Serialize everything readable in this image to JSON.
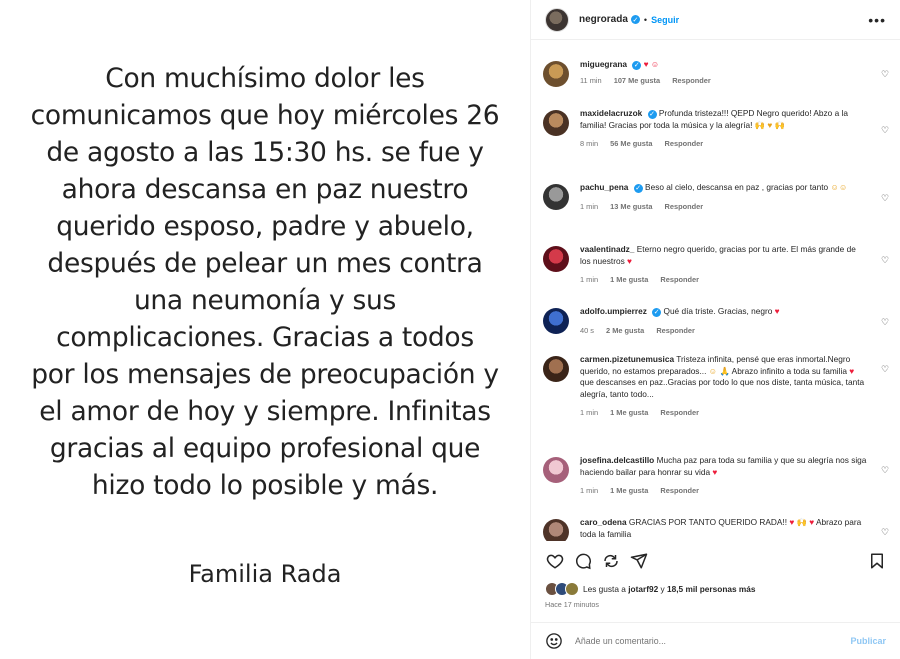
{
  "post": {
    "lines": [
      "Con muchísimo dolor les",
      "comunicamos que hoy miércoles 26",
      "de agosto a las 15:30 hs. se fue y",
      "ahora descansa en paz nuestro",
      "querido esposo, padre y abuelo,",
      "después de pelear un mes contra",
      "una neumonía y sus",
      "complicaciones. Gracias a todos",
      "por los mensajes de preocupación y",
      "el amor de hoy y siempre. Infinitas",
      "gracias al equipo profesional que",
      "hizo todo lo posible y más."
    ],
    "signature": "Familia Rada"
  },
  "header": {
    "username": "negrorada",
    "verified_icon": "verified-badge-icon",
    "follow_label": "Seguir",
    "more_icon": "more-options-icon"
  },
  "comments": [
    {
      "user": "miguegrana",
      "verified": true,
      "text": "",
      "emoji": "♥ ☺",
      "time": "11 min",
      "likes": "107 Me gusta",
      "reply": "Responder",
      "avatar_color": "#8a6a3a"
    },
    {
      "user": "maxidelacruzok",
      "verified": false,
      "text": "Profunda tristeza!!! QEPD Negro querido! Abzo a la familia! Gracias por toda la música y la alegría!",
      "emoji": "🙌 ♥ 🙌",
      "time": "8 min",
      "likes": "56 Me gusta",
      "reply": "Responder",
      "avatar_color": "#6b4a32"
    },
    {
      "user": "pachu_pena",
      "verified": true,
      "text": "Beso al cielo, descansa en paz , gracias por tanto",
      "emoji": "☺☺",
      "time": "1 min",
      "likes": "13 Me gusta",
      "reply": "Responder",
      "avatar_color": "#4a4a4a"
    },
    {
      "user": "vaalentinadz_",
      "verified": false,
      "text": "Eterno negro querido, gracias por tu arte. El más grande de los nuestros",
      "emoji": "♥",
      "time": "1 min",
      "likes": "1 Me gusta",
      "reply": "Responder",
      "avatar_color": "#9b1b2a"
    },
    {
      "user": "adolfo.umpierrez",
      "verified": true,
      "text": "Qué día triste. Gracias, negro",
      "emoji": "♥",
      "time": "40 s",
      "likes": "2 Me gusta",
      "reply": "Responder",
      "avatar_color": "#1c3f8f"
    },
    {
      "user": "carmen.pizetunemusica",
      "verified": false,
      "text": "Tristeza infinita, pensé que eras inmortal.Negro querido, no estamos preparados...",
      "text2": "Abrazo infinito a toda su familia",
      "text3": "que descanses en paz..Gracias por todo lo que nos diste, tanta música, tanta alegría, tanto todo...",
      "emoji": "☺ 🙏",
      "time": "1 min",
      "likes": "1 Me gusta",
      "reply": "Responder",
      "avatar_color": "#5a3a2a"
    },
    {
      "user": "josefina.delcastillo",
      "verified": false,
      "text": "Mucha paz para toda su familia y que su alegría nos siga haciendo bailar para honrar su vida",
      "emoji": "♥",
      "time": "1 min",
      "likes": "1 Me gusta",
      "reply": "Responder",
      "avatar_color": "#c88fa0"
    },
    {
      "user": "caro_odena",
      "verified": false,
      "text": "GRACIAS POR TANTO QUERIDO RADA!!",
      "text2": "Abrazo para toda la familia",
      "emoji": "♥ 🙌 ♥",
      "time": "",
      "likes": "",
      "reply": "",
      "avatar_color": "#7a5a4a"
    }
  ],
  "actions": {
    "like_icon": "heart-icon",
    "comment_icon": "comment-icon",
    "share_icon": "repost-icon",
    "send_icon": "send-icon",
    "save_icon": "bookmark-icon"
  },
  "likes": {
    "prefix": "Les gusta a",
    "user": "jotarf92",
    "connector": "y",
    "others": "18,5 mil personas más"
  },
  "timestamp": "Hace 17 minutos",
  "add_comment": {
    "placeholder": "Añade un comentario...",
    "publish_label": "Publicar",
    "emoji_icon": "emoji-icon"
  },
  "colors": {
    "link_blue": "#0095f6",
    "publish_disabled": "#8fc7f4",
    "verified": "#1d9bf0",
    "heart_red": "#ed1c3a"
  }
}
